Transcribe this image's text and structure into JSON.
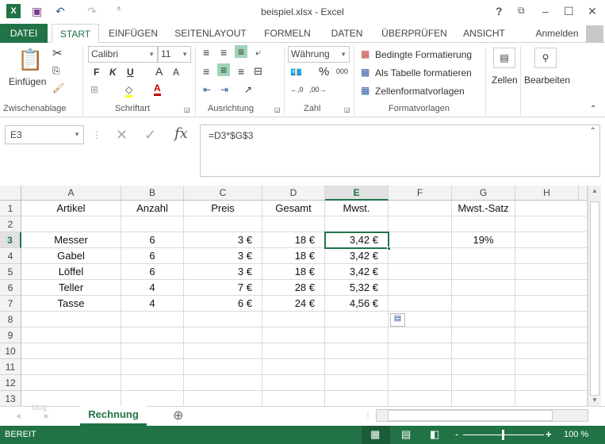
{
  "window": {
    "title": "beispiel.xlsx - Excel"
  },
  "tabs": [
    "DATEI",
    "START",
    "EINFÜGEN",
    "SEITENLAYOUT",
    "FORMELN",
    "DATEN",
    "ÜBERPRÜFEN",
    "ANSICHT"
  ],
  "account": "Anmelden",
  "ribbon": {
    "clipboard": {
      "paste": "Einfügen",
      "label": "Zwischenablage"
    },
    "font": {
      "name": "Calibri",
      "size": "11",
      "bold": "F",
      "italic": "K",
      "underline": "U",
      "label": "Schriftart"
    },
    "alignment": {
      "label": "Ausrichtung"
    },
    "number": {
      "format": "Währung",
      "percent": "%",
      "thousands": "000",
      "label": "Zahl"
    },
    "styles": {
      "conditional": "Bedingte Formatierung",
      "table": "Als Tabelle formatieren",
      "cellstyles": "Zellenformatvorlagen",
      "label": "Formatvorlagen"
    },
    "cells": {
      "label": "Zellen"
    },
    "editing": {
      "label": "Bearbeiten"
    }
  },
  "formula_bar": {
    "name_box": "E3",
    "formula": "=D3*$G$3",
    "fx": "fx"
  },
  "columns": [
    "A",
    "B",
    "C",
    "D",
    "E",
    "F",
    "G",
    "H"
  ],
  "rows": [
    "1",
    "2",
    "3",
    "4",
    "5",
    "6",
    "7",
    "8",
    "9",
    "10",
    "11",
    "12",
    "13"
  ],
  "cells": [
    [
      "Artikel",
      "Anzahl",
      "Preis",
      "Gesamt",
      "Mwst.",
      "",
      "Mwst.-Satz",
      ""
    ],
    [
      "",
      "",
      "",
      "",
      "",
      "",
      "",
      ""
    ],
    [
      "Messer",
      "6",
      "3 €",
      "18 €",
      "3,42 €",
      "",
      "19%",
      ""
    ],
    [
      "Gabel",
      "6",
      "3 €",
      "18 €",
      "3,42 €",
      "",
      "",
      ""
    ],
    [
      "Löffel",
      "6",
      "3 €",
      "18 €",
      "3,42 €",
      "",
      "",
      ""
    ],
    [
      "Teller",
      "4",
      "7 €",
      "28 €",
      "5,32 €",
      "",
      "",
      ""
    ],
    [
      "Tasse",
      "4",
      "6 €",
      "24 €",
      "4,56 €",
      "",
      "",
      ""
    ]
  ],
  "sheets": {
    "active": "Rechnung",
    "hidden_label": "blog"
  },
  "status": {
    "mode": "BEREIT",
    "zoom": "100 %"
  }
}
